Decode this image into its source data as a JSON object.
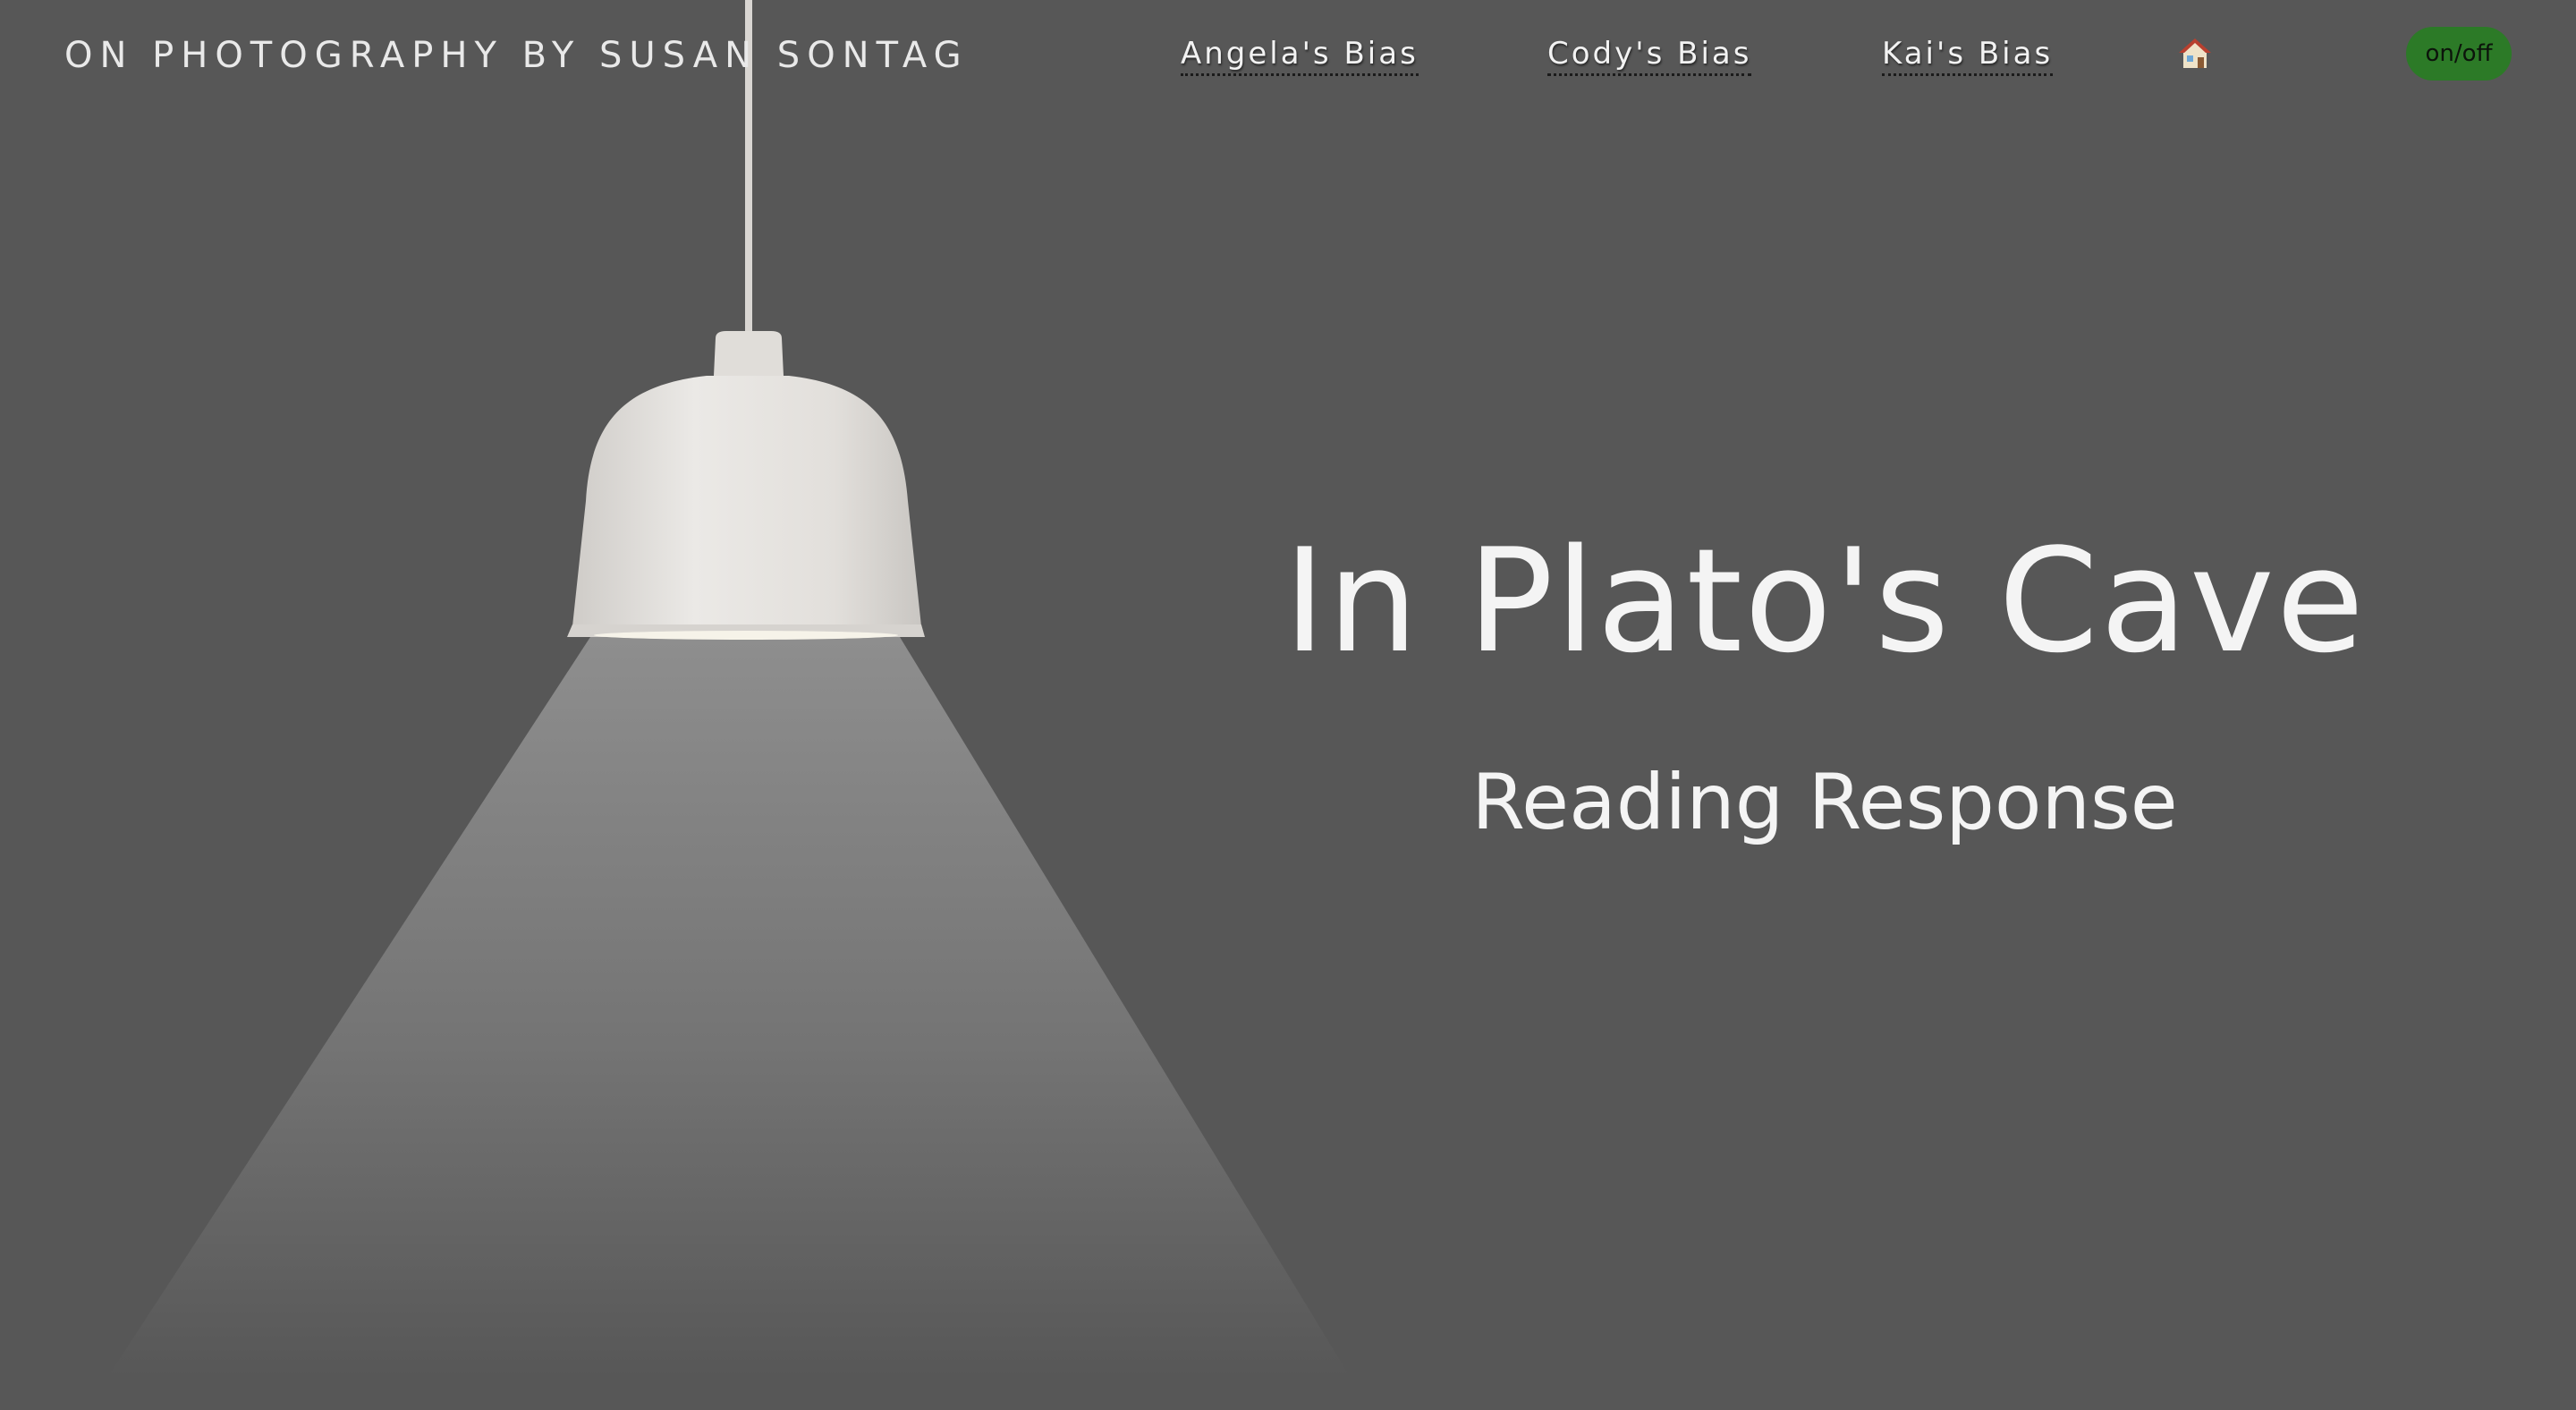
{
  "site": {
    "title": "ON PHOTOGRAPHY BY SUSAN SONTAG"
  },
  "nav": {
    "links": [
      {
        "label": "Angela's Bias"
      },
      {
        "label": "Cody's Bias"
      },
      {
        "label": "Kai's Bias"
      }
    ],
    "home_icon": "house-icon",
    "toggle_label": "on/off"
  },
  "hero": {
    "title": "In Plato's Cave",
    "subtitle": "Reading Response"
  },
  "colors": {
    "background": "#575757",
    "text": "#f4f4f4",
    "toggle_bg": "#2c7a27",
    "lamp_shade": "#e4e2df"
  }
}
